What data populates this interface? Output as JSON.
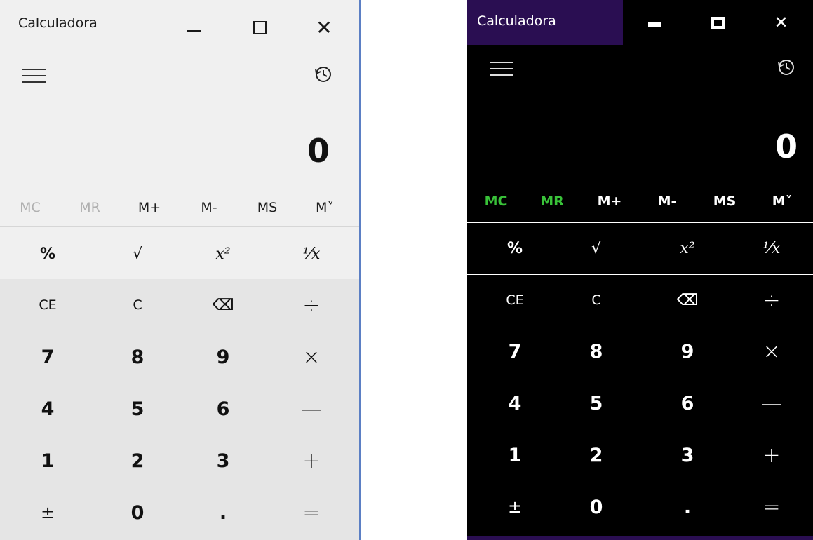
{
  "light": {
    "title": "Calculadora",
    "window_controls": {
      "close": "✕"
    },
    "display": "0",
    "memory": [
      "MC",
      "MR",
      "M+",
      "M-",
      "MS",
      "M˅"
    ],
    "functions": [
      {
        "label": "%",
        "icon": "percent"
      },
      {
        "label": "√",
        "icon": "square-root"
      },
      {
        "label": "x²",
        "icon": "square"
      },
      {
        "label": "¹⁄x",
        "icon": "reciprocal"
      }
    ],
    "keys": [
      [
        "CE",
        "C",
        "⌫",
        "÷"
      ],
      [
        "7",
        "8",
        "9",
        "×"
      ],
      [
        "4",
        "5",
        "6",
        "—"
      ],
      [
        "1",
        "2",
        "3",
        "+"
      ],
      [
        "±",
        "0",
        ".",
        "="
      ]
    ],
    "colors": {
      "background": "#f0f0f0",
      "keypad": "#e5e5e5",
      "border": "#5b7fc4",
      "memory_disabled": "#b0b0b0"
    }
  },
  "dark": {
    "title": "Calculadora",
    "window_controls": {
      "close": "✕"
    },
    "display": "0",
    "memory": [
      "MC",
      "MR",
      "M+",
      "M-",
      "MS",
      "M˅"
    ],
    "functions": [
      {
        "label": "%",
        "icon": "percent"
      },
      {
        "label": "√",
        "icon": "square-root"
      },
      {
        "label": "x²",
        "icon": "square"
      },
      {
        "label": "¹⁄x",
        "icon": "reciprocal"
      }
    ],
    "keys": [
      [
        "CE",
        "C",
        "⌫",
        "÷"
      ],
      [
        "7",
        "8",
        "9",
        "×"
      ],
      [
        "4",
        "5",
        "6",
        "—"
      ],
      [
        "1",
        "2",
        "3",
        "+"
      ],
      [
        "±",
        "0",
        ".",
        "="
      ]
    ],
    "colors": {
      "background": "#000000",
      "title_accent": "#2a0e52",
      "memory_active": "#39c239",
      "text": "#ffffff"
    }
  }
}
